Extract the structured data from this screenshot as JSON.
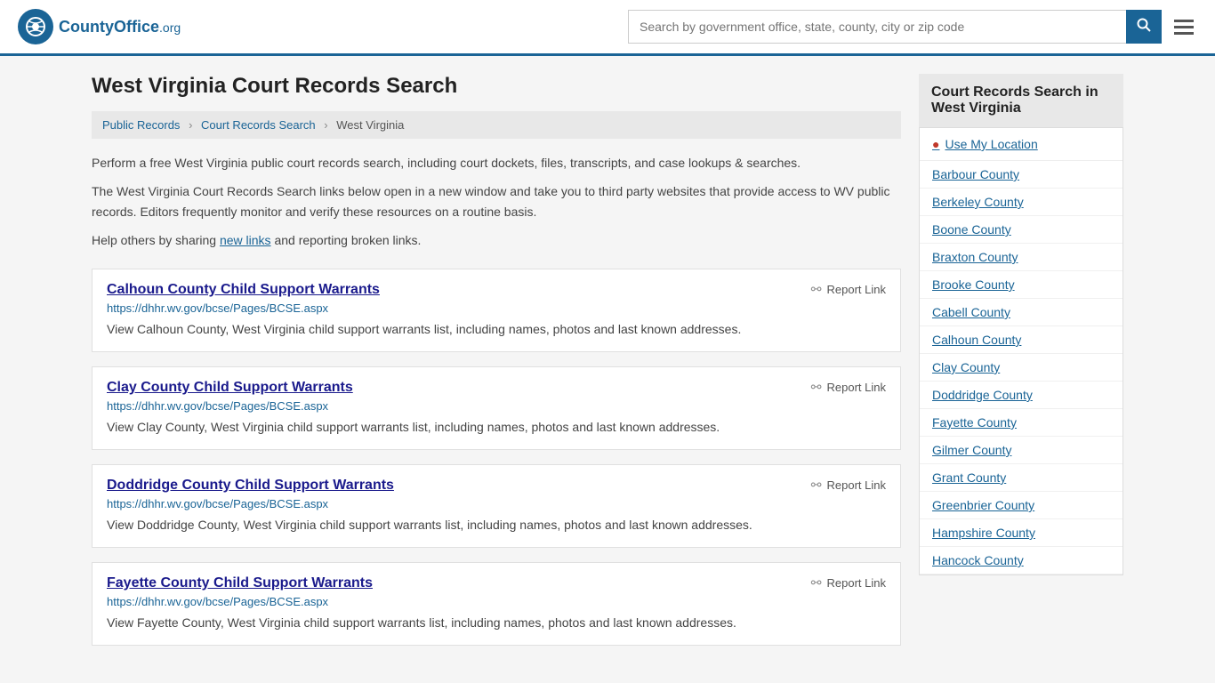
{
  "header": {
    "logo_text": "CountyOffice",
    "logo_org": ".org",
    "search_placeholder": "Search by government office, state, county, city or zip code"
  },
  "page": {
    "title": "West Virginia Court Records Search"
  },
  "breadcrumb": {
    "items": [
      {
        "label": "Public Records",
        "href": "#"
      },
      {
        "label": "Court Records Search",
        "href": "#"
      },
      {
        "label": "West Virginia",
        "href": "#"
      }
    ]
  },
  "intro": {
    "primary": "Perform a free West Virginia public court records search, including court dockets, files, transcripts, and case lookups & searches.",
    "secondary": "The West Virginia Court Records Search links below open in a new window and take you to third party websites that provide access to WV public records. Editors frequently monitor and verify these resources on a routine basis.",
    "share_prefix": "Help others by sharing ",
    "share_link_text": "new links",
    "share_suffix": " and reporting broken links."
  },
  "results": [
    {
      "title": "Calhoun County Child Support Warrants",
      "url": "https://dhhr.wv.gov/bcse/Pages/BCSE.aspx",
      "desc": "View Calhoun County, West Virginia child support warrants list, including names, photos and last known addresses."
    },
    {
      "title": "Clay County Child Support Warrants",
      "url": "https://dhhr.wv.gov/bcse/Pages/BCSE.aspx",
      "desc": "View Clay County, West Virginia child support warrants list, including names, photos and last known addresses."
    },
    {
      "title": "Doddridge County Child Support Warrants",
      "url": "https://dhhr.wv.gov/bcse/Pages/BCSE.aspx",
      "desc": "View Doddridge County, West Virginia child support warrants list, including names, photos and last known addresses."
    },
    {
      "title": "Fayette County Child Support Warrants",
      "url": "https://dhhr.wv.gov/bcse/Pages/BCSE.aspx",
      "desc": "View Fayette County, West Virginia child support warrants list, including names, photos and last known addresses."
    }
  ],
  "report_label": "Report Link",
  "sidebar": {
    "title": "Court Records Search in West Virginia",
    "use_location_label": "Use My Location",
    "counties": [
      "Barbour County",
      "Berkeley County",
      "Boone County",
      "Braxton County",
      "Brooke County",
      "Cabell County",
      "Calhoun County",
      "Clay County",
      "Doddridge County",
      "Fayette County",
      "Gilmer County",
      "Grant County",
      "Greenbrier County",
      "Hampshire County",
      "Hancock County"
    ]
  }
}
